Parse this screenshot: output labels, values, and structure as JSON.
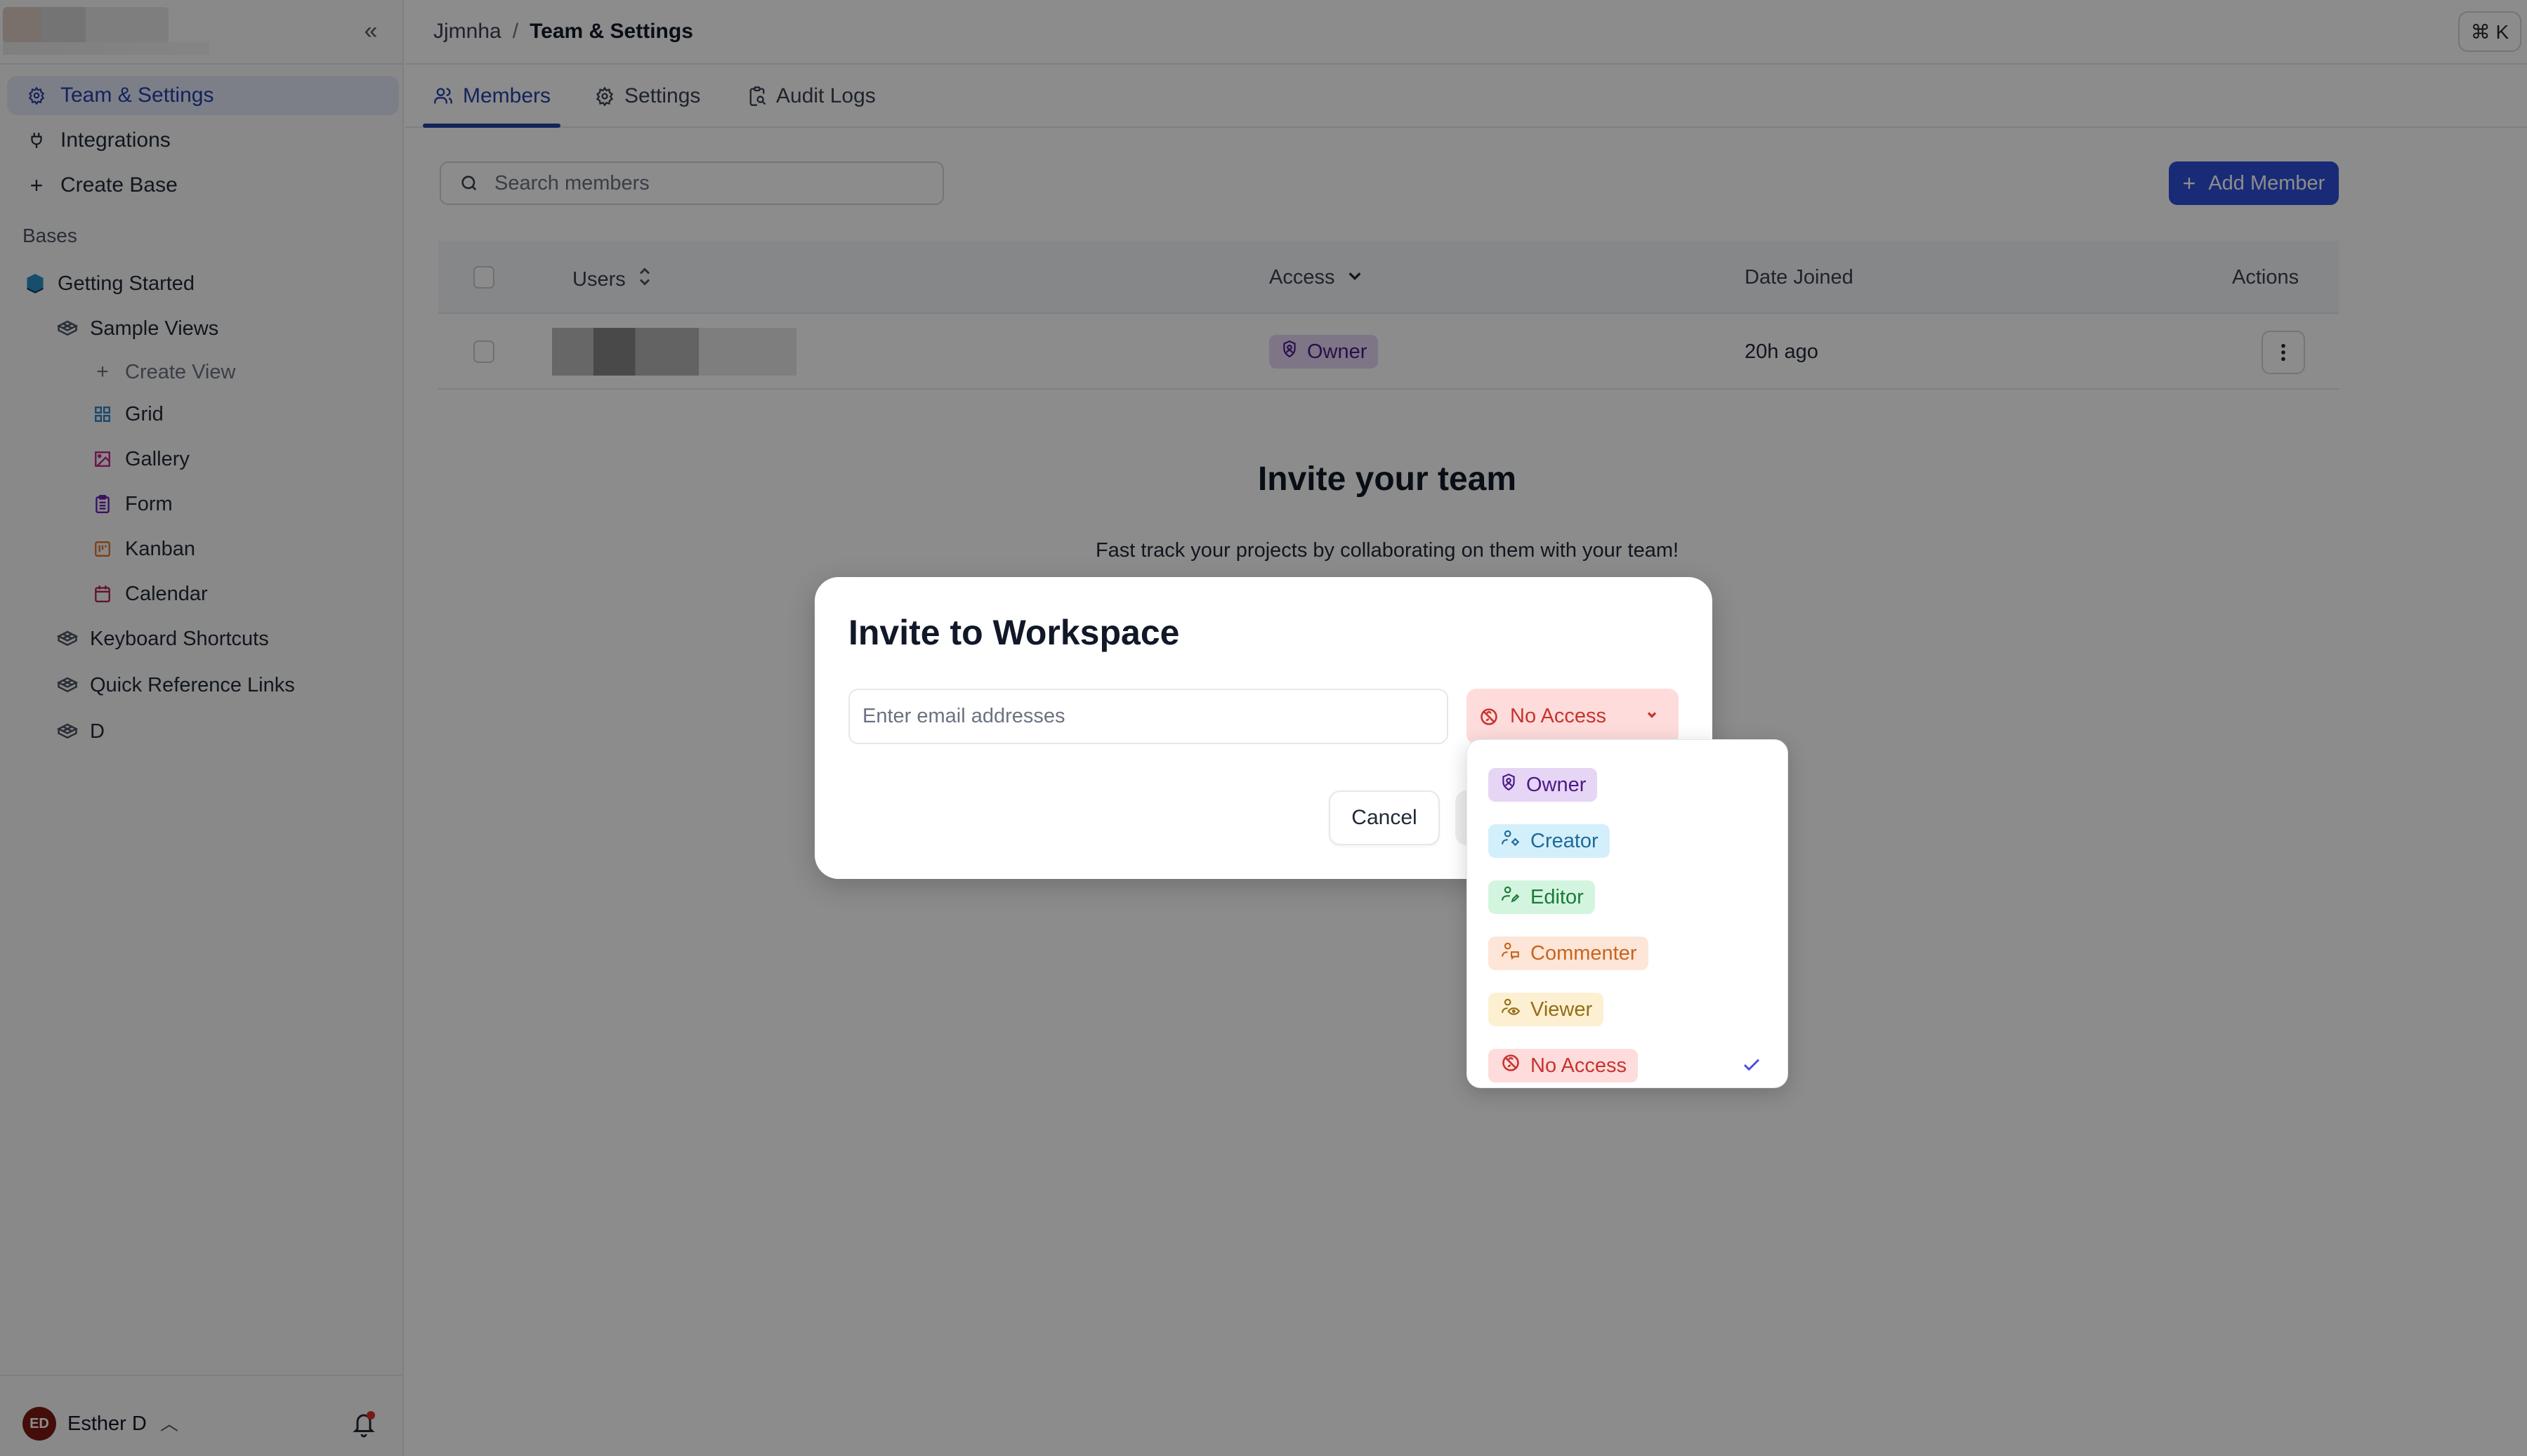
{
  "sidebar": {
    "collapse_icon": "double-chevron-left-icon",
    "nav": [
      {
        "label": "Team & Settings",
        "icon": "gear-icon",
        "active": true
      },
      {
        "label": "Integrations",
        "icon": "plug-icon"
      },
      {
        "label": "Create Base",
        "icon": "plus-icon"
      }
    ],
    "bases_label": "Bases",
    "base": {
      "label": "Getting Started",
      "icon": "base-cube-icon"
    },
    "tables": [
      {
        "label": "Sample Views",
        "icon": "table-icon"
      },
      {
        "label": "Keyboard Shortcuts",
        "icon": "table-icon"
      },
      {
        "label": "Quick Reference Links",
        "icon": "table-icon"
      },
      {
        "label": "D",
        "icon": "table-icon"
      }
    ],
    "views": [
      {
        "label": "Create View",
        "icon": "plus-icon"
      },
      {
        "label": "Grid",
        "icon": "grid-view-icon",
        "color": "#2f83c4"
      },
      {
        "label": "Gallery",
        "icon": "gallery-view-icon",
        "color": "#c2268a"
      },
      {
        "label": "Form",
        "icon": "form-view-icon",
        "color": "#6b1fb8"
      },
      {
        "label": "Kanban",
        "icon": "kanban-view-icon",
        "color": "#e2772d"
      },
      {
        "label": "Calendar",
        "icon": "calendar-view-icon",
        "color": "#b3264f"
      }
    ],
    "user": {
      "initials": "ED",
      "name": "Esther D",
      "avatar_color": "#7a1a12"
    },
    "notifications_icon": "bell-icon"
  },
  "topbar": {
    "breadcrumb": {
      "workspace": "Jjmnha",
      "separator": "/",
      "current": "Team & Settings"
    },
    "shortcut": "⌘ K"
  },
  "tabs": [
    {
      "label": "Members",
      "icon": "users-icon",
      "active": true
    },
    {
      "label": "Settings",
      "icon": "gear-icon"
    },
    {
      "label": "Audit Logs",
      "icon": "clipboard-search-icon"
    }
  ],
  "members": {
    "search_placeholder": "Search members",
    "add_member_label": "Add Member",
    "columns": {
      "users": "Users",
      "access": "Access",
      "date_joined": "Date Joined",
      "actions": "Actions"
    },
    "rows": [
      {
        "user": "",
        "access": "Owner",
        "date_joined": "20h ago"
      }
    ],
    "empty_title": "Invite your team",
    "empty_subtitle": "Fast track your projects by collaborating on them with your team!"
  },
  "modal": {
    "title": "Invite to Workspace",
    "email_placeholder": "Enter email addresses",
    "selected_role": "No Access",
    "cancel_label": "Cancel"
  },
  "roles": [
    {
      "label": "Owner",
      "icon": "shield-user-icon",
      "bg": "#e6d5f5",
      "fg": "#4c1a87",
      "selected": false
    },
    {
      "label": "Creator",
      "icon": "user-gear-icon",
      "bg": "#d4effc",
      "fg": "#1d6b97",
      "selected": false
    },
    {
      "label": "Editor",
      "icon": "user-pencil-icon",
      "bg": "#d3f5df",
      "fg": "#1c7a3a",
      "selected": false
    },
    {
      "label": "Commenter",
      "icon": "user-comment-icon",
      "bg": "#fde6d8",
      "fg": "#c8641f",
      "selected": false
    },
    {
      "label": "Viewer",
      "icon": "user-eye-icon",
      "bg": "#fdf0d2",
      "fg": "#946d16",
      "selected": false
    },
    {
      "label": "No Access",
      "icon": "no-access-icon",
      "bg": "#fddcdb",
      "fg": "#c8332e",
      "selected": true
    }
  ],
  "colors": {
    "accent": "#2340a8",
    "primary_button": "#2f4fd8",
    "check": "#4a4fe0"
  }
}
